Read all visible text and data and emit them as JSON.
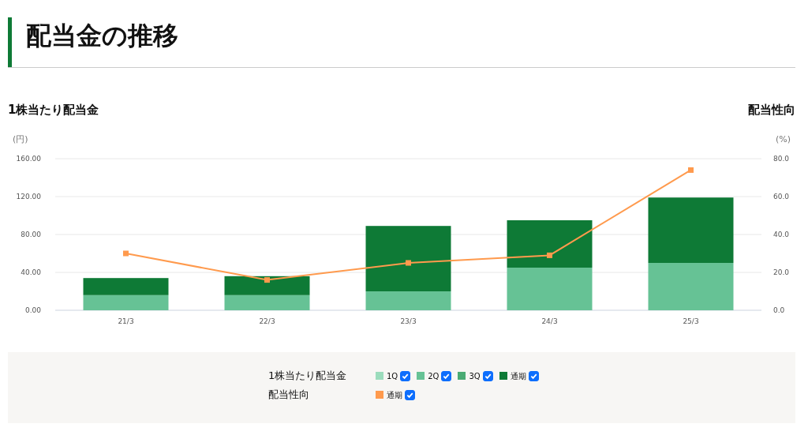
{
  "title": "配当金の推移",
  "axis_titles": {
    "left": "1株当たり配当金",
    "right": "配当性向"
  },
  "units": {
    "left": "(円)",
    "right": "(%)"
  },
  "chart_data": {
    "type": "bar",
    "stacked": true,
    "grid": true,
    "categories": [
      "21/3",
      "22/3",
      "23/3",
      "24/3",
      "25/3"
    ],
    "ylim": [
      0,
      160
    ],
    "yticks": [
      {
        "value": 0,
        "label": "0.00"
      },
      {
        "value": 40,
        "label": "40.00"
      },
      {
        "value": 80,
        "label": "80.00"
      },
      {
        "value": 120,
        "label": "120.00"
      },
      {
        "value": 160,
        "label": "160.00"
      }
    ],
    "y2lim": [
      0,
      80
    ],
    "y2ticks": [
      {
        "value": 0,
        "label": "0.0"
      },
      {
        "value": 20,
        "label": "20.0"
      },
      {
        "value": 40,
        "label": "40.0"
      },
      {
        "value": 60,
        "label": "60.0"
      },
      {
        "value": 80,
        "label": "80.0"
      }
    ],
    "series": [
      {
        "name": "1Q",
        "color": "#9bdcbc",
        "values": [
          0,
          0,
          0,
          0,
          0
        ]
      },
      {
        "name": "2Q",
        "color": "#66c295",
        "values": [
          16,
          16,
          20,
          45,
          50
        ]
      },
      {
        "name": "3Q",
        "color": "#4aab74",
        "values": [
          0,
          0,
          0,
          0,
          0
        ]
      },
      {
        "name": "通期",
        "color": "#0e7a36",
        "values": [
          18,
          20,
          69,
          50,
          69
        ]
      },
      {
        "name": "通期",
        "color": "#ff9a4d",
        "type": "line",
        "axis": "y2",
        "marker": "square",
        "values": [
          30,
          16,
          25,
          29,
          74
        ]
      }
    ]
  },
  "legend_groups": [
    {
      "label": "1株当たり配当金",
      "checks": [
        {
          "checked": true
        },
        {
          "checked": true
        },
        {
          "checked": true
        },
        {
          "checked": true
        }
      ]
    },
    {
      "label": "配当性向",
      "checks": [
        {
          "checked": true
        }
      ]
    }
  ]
}
